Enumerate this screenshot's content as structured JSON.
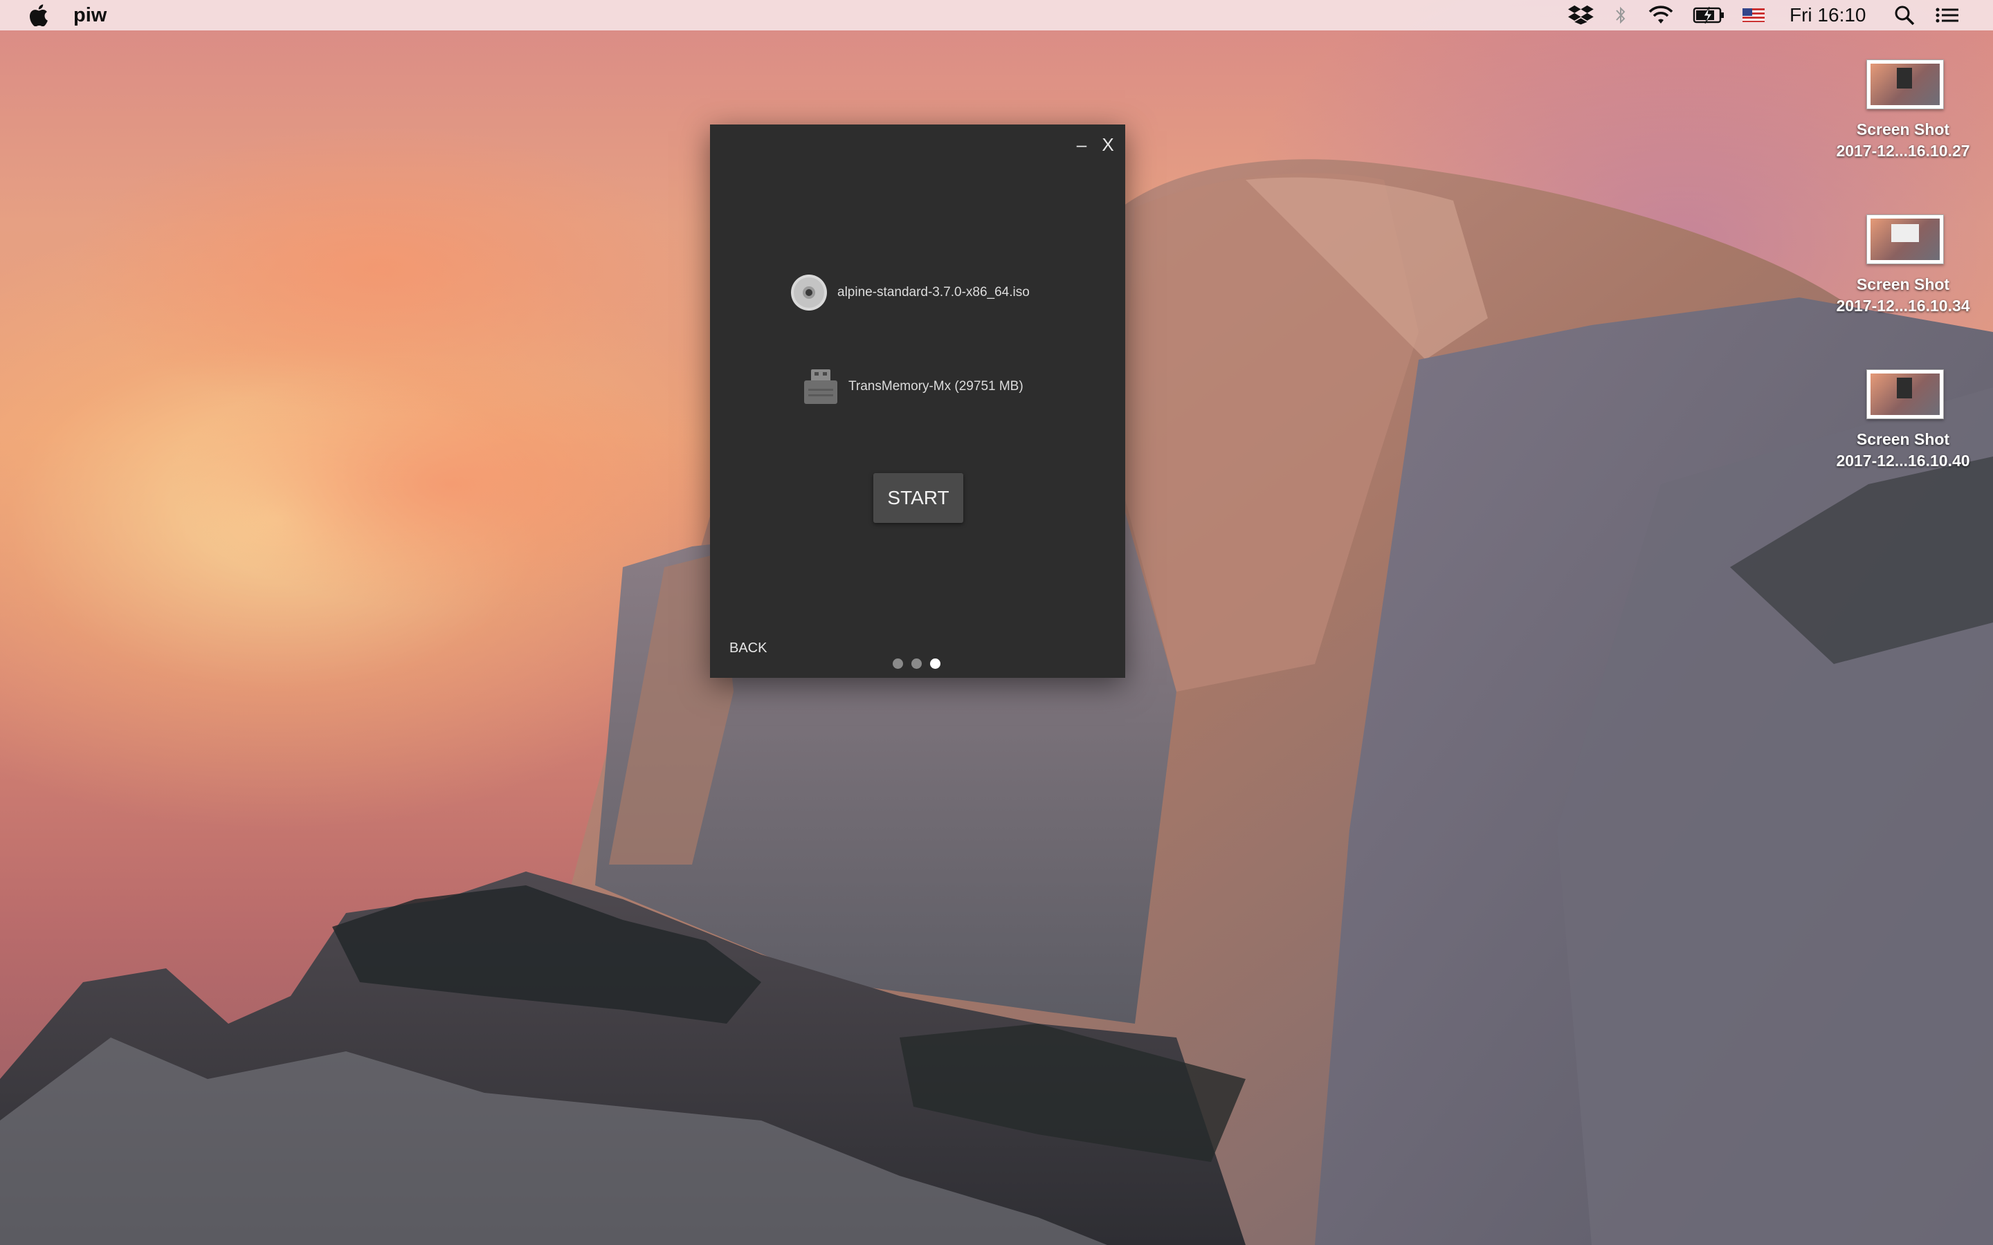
{
  "menubar": {
    "app_name": "piw",
    "clock": "Fri 16:10",
    "status_icons": [
      "dropbox-icon",
      "bluetooth-icon",
      "wifi-icon",
      "battery-charging-icon",
      "us-flag-icon",
      "spotlight-search-icon",
      "notification-center-icon"
    ]
  },
  "desktop": {
    "icons": [
      {
        "line1": "Screen Shot",
        "line2": "2017-12...16.10.27"
      },
      {
        "line1": "Screen Shot",
        "line2": "2017-12...16.10.34"
      },
      {
        "line1": "Screen Shot",
        "line2": "2017-12...16.10.40"
      }
    ]
  },
  "window": {
    "minimize_label": "–",
    "close_label": "X",
    "image_file": "alpine-standard-3.7.0-x86_64.iso",
    "target_drive": "TransMemory-Mx (29751 MB)",
    "start_label": "START",
    "back_label": "BACK",
    "steps_total": 3,
    "current_step": 3
  },
  "colors": {
    "window_bg": "#2d2d2d",
    "button_bg": "#4a4a4a",
    "active_dot": "#ffffff",
    "inactive_dot": "#8a8a8a"
  }
}
